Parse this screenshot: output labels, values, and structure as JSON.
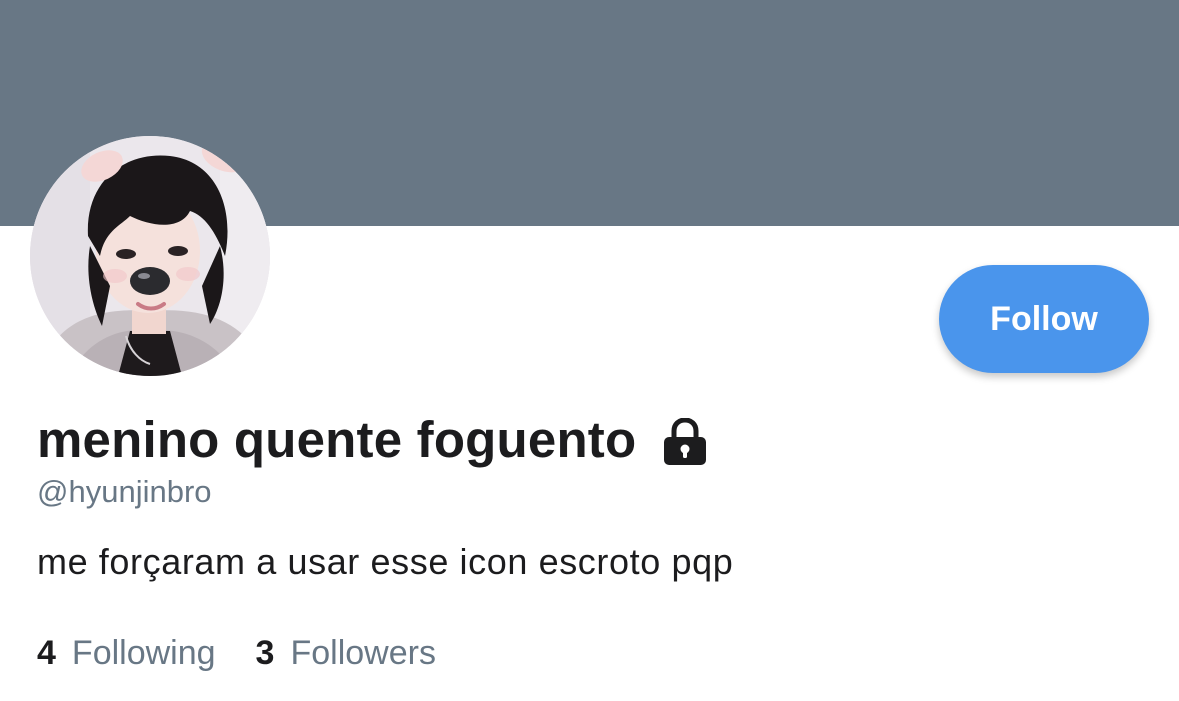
{
  "profile": {
    "display_name": "menino quente foguento",
    "handle": "@hyunjinbro",
    "bio": "me forçaram a usar esse icon escroto pqp",
    "protected_icon": "lock-icon",
    "avatar": "profile-photo"
  },
  "actions": {
    "follow_label": "Follow"
  },
  "stats": {
    "following_count": "4",
    "following_label": "Following",
    "followers_count": "3",
    "followers_label": "Followers"
  },
  "colors": {
    "banner": "#687785",
    "follow_button": "#4a95ec",
    "secondary_text": "#687785",
    "primary_text": "#1c1c1e"
  }
}
